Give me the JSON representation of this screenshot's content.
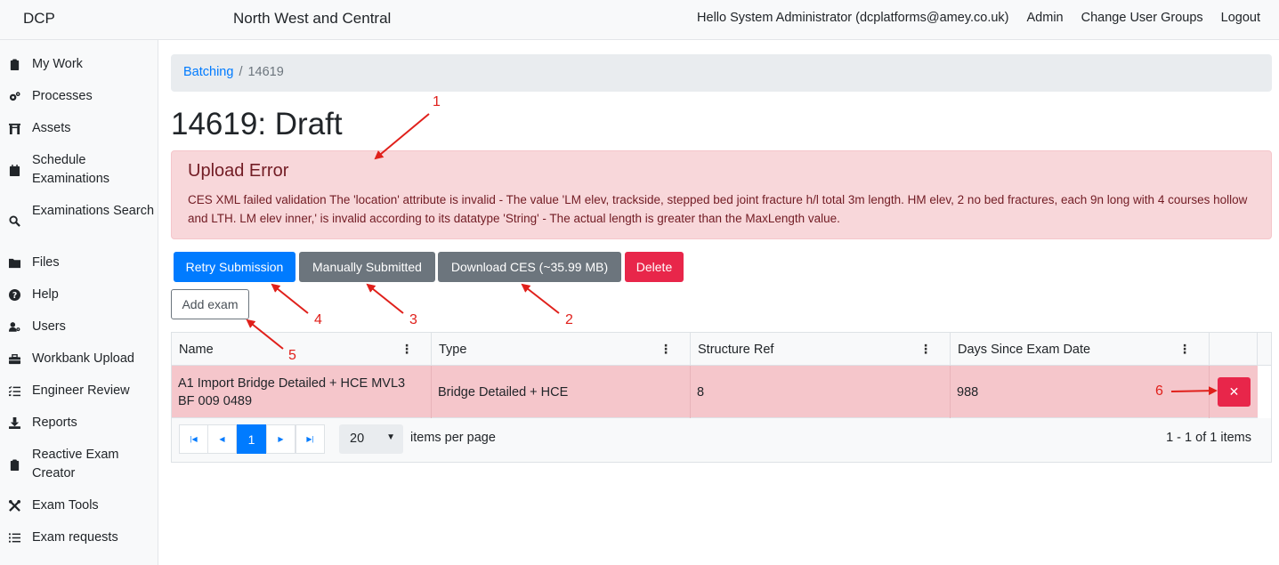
{
  "topbar": {
    "brand": "DCP",
    "region": "North West and Central",
    "greeting": "Hello System Administrator (dcplatforms@amey.co.uk)",
    "admin": "Admin",
    "change_groups": "Change User Groups",
    "logout": "Logout"
  },
  "sidebar": {
    "items": [
      {
        "label": "My Work",
        "icon": "clipboard-icon"
      },
      {
        "label": "Processes",
        "icon": "cogs-icon"
      },
      {
        "label": "Assets",
        "icon": "archway-icon"
      },
      {
        "label": "Schedule Examinations",
        "icon": "calendar-icon"
      },
      {
        "label": "Examinations Search",
        "icon": "search-icon"
      },
      {
        "label": "Files",
        "icon": "folder-icon"
      },
      {
        "label": "Help",
        "icon": "question-circle-icon"
      },
      {
        "label": "Users",
        "icon": "user-cog-icon"
      },
      {
        "label": "Workbank Upload",
        "icon": "toolbox-icon"
      },
      {
        "label": "Engineer Review",
        "icon": "tasks-icon"
      },
      {
        "label": "Reports",
        "icon": "download-icon"
      },
      {
        "label": "Reactive Exam Creator",
        "icon": "clipboard-icon"
      },
      {
        "label": "Exam Tools",
        "icon": "tools-icon"
      },
      {
        "label": "Exam requests",
        "icon": "list-icon"
      }
    ]
  },
  "breadcrumb": {
    "parent": "Batching",
    "separator": "/",
    "current": "14619"
  },
  "page": {
    "title": "14619: Draft"
  },
  "alert": {
    "title": "Upload Error",
    "message": "CES XML failed validation The 'location' attribute is invalid - The value 'LM elev, trackside, stepped bed joint fracture h/l total 3m length. HM elev, 2 no bed fractures, each 9n long with 4 courses hollow and LTH. LM elev inner,' is invalid according to its datatype 'String' - The actual length is greater than the MaxLength value."
  },
  "actions": {
    "retry": "Retry Submission",
    "manual": "Manually Submitted",
    "download": "Download CES (~35.99 MB)",
    "delete": "Delete",
    "add_exam": "Add exam"
  },
  "grid": {
    "columns": [
      "Name",
      "Type",
      "Structure Ref",
      "Days Since Exam Date"
    ],
    "rows": [
      {
        "name": "A1 Import Bridge Detailed + HCE MVL3 BF 009 0489",
        "type": "Bridge Detailed + HCE",
        "structure_ref": "8",
        "days": "988"
      }
    ],
    "pager": {
      "current_page": "1",
      "page_size": "20",
      "items_per_page_label": "items per page",
      "info": "1 - 1 of 1 items"
    }
  },
  "annotations": [
    "1",
    "2",
    "3",
    "4",
    "5",
    "6"
  ],
  "colors": {
    "primary": "#007bff",
    "secondary": "#6c757d",
    "danger": "#e8264a",
    "alert_bg": "#f8d7da",
    "row_error_bg": "#f5c6cb",
    "annotation": "#e0201b"
  }
}
